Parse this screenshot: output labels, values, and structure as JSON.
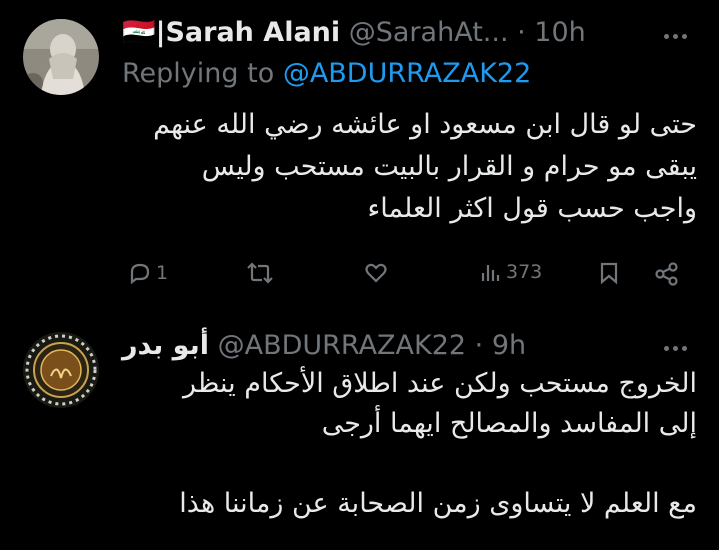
{
  "tweet1": {
    "flag": "🇮🇶",
    "name": "|Sarah Alani",
    "handle": "@SarahAt...",
    "time": "· 10h",
    "replying_label": "Replying to",
    "replying_handle": "@ABDURRAZAK22",
    "lines": [
      "حتى لو قال ابن مسعود او عائشه رضي الله عنهم",
      "يبقى مو حرام و القرار بالبيت مستحب وليس",
      "واجب حسب قول اكثر العلماء"
    ],
    "reply_count": "1",
    "views_count": "373",
    "icons": [
      "reply-icon",
      "retweet-icon",
      "like-icon",
      "views-icon",
      "bookmark-icon",
      "share-icon"
    ]
  },
  "tweet2": {
    "name": "أبو بدر",
    "handle": "@ABDURRAZAK22",
    "time": "· 9h",
    "lines": [
      "الخروج مستحب ولكن عند اطلاق الأحكام ينظر",
      "إلى المفاسد والمصالح ايهما أرجى",
      "",
      "مع العلم لا يتساوى زمن الصحابة عن زماننا هذا"
    ]
  },
  "colors": {
    "background": "#000000",
    "text": "#e7e9ea",
    "muted": "#71767b",
    "link": "#1d9bf0"
  }
}
